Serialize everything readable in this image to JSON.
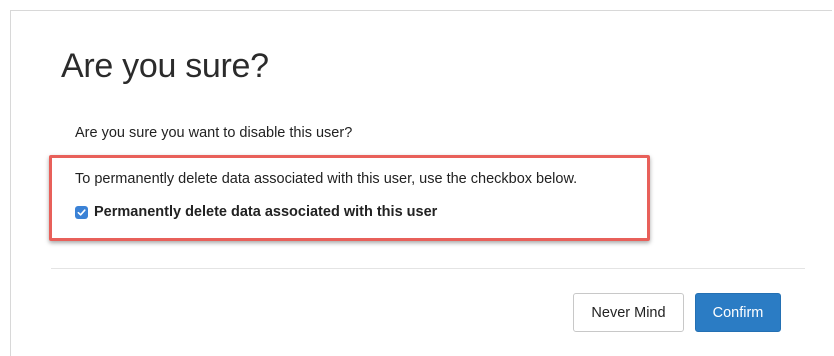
{
  "dialog": {
    "title": "Are you sure?",
    "question": "Are you sure you want to disable this user?",
    "delete_info": "To permanently delete data associated with this user, use the checkbox below.",
    "checkbox": {
      "label": "Permanently delete data associated with this user",
      "checked": true
    },
    "buttons": {
      "cancel_label": "Never Mind",
      "confirm_label": "Confirm"
    }
  },
  "colors": {
    "highlight_border": "#e8605a",
    "primary_button": "#2b7cc4",
    "checkbox_fill": "#3b82d6"
  },
  "icons": {
    "checkbox": "checkmark-icon"
  }
}
